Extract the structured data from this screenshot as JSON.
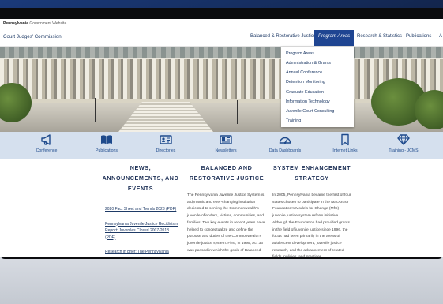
{
  "gov_bar": {
    "brand": "Pennsylvania",
    "text": "Government Website"
  },
  "header": {
    "site_title": "Court Judges' Commission",
    "nav": [
      {
        "label": "Balanced & Restorative Justice"
      },
      {
        "label": "Program Areas"
      },
      {
        "label": "Research & Statistics"
      },
      {
        "label": "Publications"
      },
      {
        "label": "A"
      }
    ]
  },
  "dropdown": {
    "items": [
      "Program Areas",
      "Administration & Grants",
      "Annual Conference",
      "Detention Monitoring",
      "Graduate Education",
      "Information Technology",
      "Juvenile Court Consulting",
      "Training"
    ]
  },
  "quick_links": [
    {
      "label": "Conference",
      "icon": "megaphone-icon"
    },
    {
      "label": "Publications",
      "icon": "book-icon"
    },
    {
      "label": "Directories",
      "icon": "contact-card-icon"
    },
    {
      "label": "Newsletters",
      "icon": "newspaper-icon"
    },
    {
      "label": "Data Dashboards",
      "icon": "gauge-icon"
    },
    {
      "label": "Internet Links",
      "icon": "bookmark-icon"
    },
    {
      "label": "Training - JCMS",
      "icon": "diamond-icon"
    }
  ],
  "columns": {
    "news": {
      "heading": "NEWS, ANNOUNCEMENTS, AND EVENTS",
      "links": [
        "2020 Fact Sheet and Trends 2023 (PDF)",
        "Pennsylvania Juvenile Justice Recidivism Report: Juveniles Closed 2007-2018 (PDF)",
        "Research in Brief: The Pennsylvania Juvenile Justice Recidivism Report"
      ]
    },
    "balanced": {
      "heading": "BALANCED AND RESTORATIVE JUSTICE",
      "body": "The Pennsylvania Juvenile Justice System is a dynamic and ever-changing institution dedicated to serving the Commonwealth's juvenile offenders, victims, communities, and families. Two key events in recent years have helped to conceptualize and define the purpose and duties of the Commonwealth's juvenile justice system. First, in 1995, Act 33 was passed in which the goals of Balanced"
    },
    "strategy": {
      "heading": "SYSTEM ENHANCEMENT STRATEGY",
      "body": "In 2005, Pennsylvania became the first of four states chosen to participate in the MacArthur Foundation's Models for Change (MfC) juvenile justice system reform initiative. Although the Foundation had provided grants in the field of juvenile justice since 1996, the focus had been primarily in the areas of adolescent development, juvenile justice research, and the advancement of related fields, policies, and practices."
    }
  },
  "colors": {
    "nav_active": "#1f4592",
    "icon_blue": "#1e4a8c",
    "icon_bar_bg": "#d5e0ee",
    "backdrop_yellow": "#f6c21a"
  }
}
